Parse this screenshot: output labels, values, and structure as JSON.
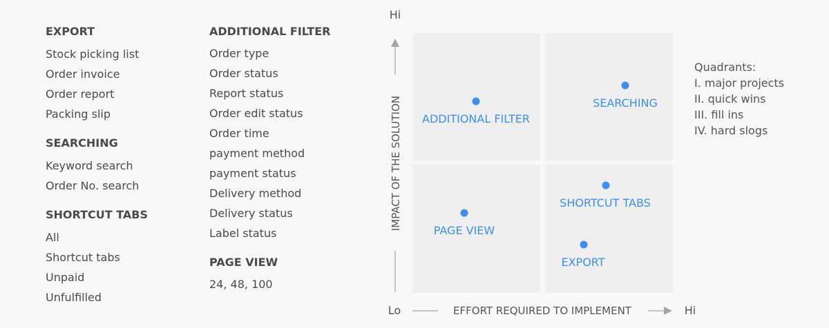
{
  "left_lists": {
    "export": {
      "heading": "EXPORT",
      "items": [
        "Stock picking list",
        "Order invoice",
        "Order report",
        "Packing slip"
      ]
    },
    "searching": {
      "heading": "SEARCHING",
      "items": [
        "Keyword search",
        "Order No. search"
      ]
    },
    "shortcut_tabs": {
      "heading": "SHORTCUT TABS",
      "items": [
        "All",
        "Shortcut tabs",
        "Unpaid",
        "Unfulfilled"
      ]
    }
  },
  "middle_lists": {
    "additional_filter": {
      "heading": "ADDITIONAL FILTER",
      "items": [
        "Order type",
        "Order status",
        "Report status",
        "Order edit status",
        "Order time",
        "payment method",
        "payment status",
        "Delivery method",
        "Delivery status",
        "Label status"
      ]
    },
    "page_view": {
      "heading": "PAGE VIEW",
      "items": [
        "24, 48, 100"
      ]
    }
  },
  "matrix": {
    "y_axis_label": "IMPACT OF THE SOLUTION",
    "x_axis_label": "EFFORT REQUIRED TO IMPLEMENT",
    "y_hi": "Hi",
    "x_lo": "Lo",
    "x_hi": "Hi",
    "points": [
      {
        "label": "ADDITIONAL FILTER"
      },
      {
        "label": "SEARCHING"
      },
      {
        "label": "PAGE VIEW"
      },
      {
        "label": "SHORTCUT TABS"
      },
      {
        "label": "EXPORT"
      }
    ],
    "colors": {
      "quadrant": "#efefef",
      "point": "#3b8ff0",
      "axis": "#a6a6a6"
    }
  },
  "quadrants_note": {
    "title": "Quadrants:",
    "lines": [
      "I. major projects",
      "II. quick wins",
      "III. fill ins",
      "IV. hard slogs"
    ]
  }
}
